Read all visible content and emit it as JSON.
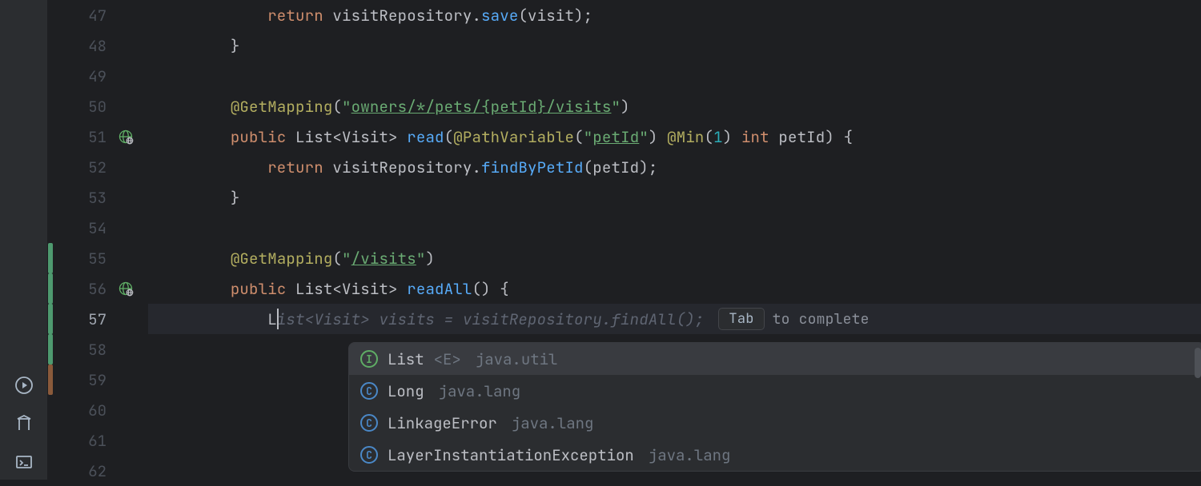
{
  "gutter": {
    "lines": [
      {
        "n": 47,
        "icon": null,
        "marker": null,
        "active": false
      },
      {
        "n": 48,
        "icon": null,
        "marker": null,
        "active": false
      },
      {
        "n": 49,
        "icon": null,
        "marker": null,
        "active": false
      },
      {
        "n": 50,
        "icon": null,
        "marker": null,
        "active": false
      },
      {
        "n": 51,
        "icon": "globe",
        "marker": null,
        "active": false
      },
      {
        "n": 52,
        "icon": null,
        "marker": null,
        "active": false
      },
      {
        "n": 53,
        "icon": null,
        "marker": null,
        "active": false
      },
      {
        "n": 54,
        "icon": null,
        "marker": null,
        "active": false
      },
      {
        "n": 55,
        "icon": null,
        "marker": "added",
        "active": false
      },
      {
        "n": 56,
        "icon": "globe",
        "marker": "added",
        "active": false
      },
      {
        "n": 57,
        "icon": null,
        "marker": "added",
        "active": true
      },
      {
        "n": 58,
        "icon": null,
        "marker": "added",
        "active": false
      },
      {
        "n": 59,
        "icon": null,
        "marker": "modified",
        "active": false
      },
      {
        "n": 60,
        "icon": null,
        "marker": null,
        "active": false
      },
      {
        "n": 61,
        "icon": null,
        "marker": null,
        "active": false
      },
      {
        "n": 62,
        "icon": null,
        "marker": null,
        "active": false
      }
    ]
  },
  "code": {
    "l47": {
      "indent": "            ",
      "kw": "return",
      "sp": " ",
      "ident": "visitRepository",
      "dot": ".",
      "method": "save",
      "paren": "(visit);"
    },
    "l48": {
      "indent": "        ",
      "brace": "}"
    },
    "l50": {
      "indent": "        ",
      "ann": "@GetMapping",
      "open": "(",
      "q1": "\"",
      "path": "owners/*/pets/{petId}/visits",
      "q2": "\"",
      "close": ")"
    },
    "l51": {
      "indent": "        ",
      "kw": "public",
      "sp1": " ",
      "type": "List<Visit>",
      "sp2": " ",
      "method": "read",
      "open": "(",
      "ann": "@PathVariable",
      "po": "(",
      "q1": "\"",
      "pv": "petId",
      "q2": "\"",
      "pc": ") ",
      "ann2": "@Min",
      "mo": "(",
      "num": "1",
      "mc": ") ",
      "kw2": "int",
      "sp3": " ",
      "param": "petId",
      "close": ") {"
    },
    "l52": {
      "indent": "            ",
      "kw": "return",
      "sp": " ",
      "ident": "visitRepository",
      "dot": ".",
      "method": "findByPetId",
      "paren": "(petId);"
    },
    "l53": {
      "indent": "        ",
      "brace": "}"
    },
    "l55": {
      "indent": "        ",
      "ann": "@GetMapping",
      "open": "(",
      "q1": "\"",
      "path": "/visits",
      "q2": "\"",
      "close": ")"
    },
    "l56": {
      "indent": "        ",
      "kw": "public",
      "sp1": " ",
      "type": "List<Visit>",
      "sp2": " ",
      "method": "readAll",
      "rest": "() {"
    },
    "l57": {
      "indent": "            ",
      "typed": "L",
      "ghost": "ist<Visit> visits = visitRepository.findAll();"
    }
  },
  "inline_hint": {
    "key": "Tab",
    "text": "to complete"
  },
  "completion": {
    "items": [
      {
        "icon": "I",
        "iconClass": "comp-icon-i",
        "name": "List",
        "generic": "<E>",
        "pkg": "java.util",
        "selected": true
      },
      {
        "icon": "C",
        "iconClass": "comp-icon-c",
        "name": "Long",
        "generic": "",
        "pkg": "java.lang",
        "selected": false
      },
      {
        "icon": "C",
        "iconClass": "comp-icon-e",
        "name": "LinkageError",
        "generic": "",
        "pkg": "java.lang",
        "selected": false
      },
      {
        "icon": "C",
        "iconClass": "comp-icon-e",
        "name": "LayerInstantiationException",
        "generic": "",
        "pkg": "java.lang",
        "selected": false
      }
    ]
  },
  "sidebar": {
    "icons": [
      "run",
      "build",
      "terminal"
    ]
  }
}
